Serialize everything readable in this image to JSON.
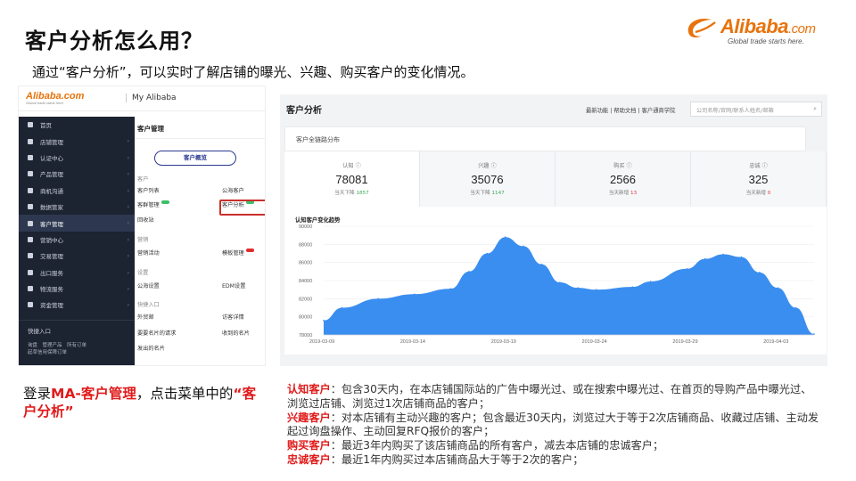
{
  "slide": {
    "title": "客户分析怎么用？",
    "subtitle": "通过“客户分析”，可以实时了解店铺的曝光、兴趣、购买客户的变化情况。"
  },
  "logo": {
    "name": "Alibaba",
    "suffix": ".com",
    "tagline": "Global trade starts here.",
    "reg": "®"
  },
  "left_shot": {
    "logo": "Alibaba.com",
    "logo_tag": "Global trade starts here.",
    "my_alibaba": "My Alibaba",
    "nav": [
      {
        "label": "首页",
        "icon": "home-icon"
      },
      {
        "label": "店铺管理",
        "icon": "store-icon"
      },
      {
        "label": "认证中心",
        "icon": "shield-icon"
      },
      {
        "label": "产品管理",
        "icon": "grid-icon"
      },
      {
        "label": "商机沟通",
        "icon": "chat-icon"
      },
      {
        "label": "数据管家",
        "icon": "chart-icon"
      },
      {
        "label": "客户管理",
        "icon": "user-icon"
      },
      {
        "label": "营销中心",
        "icon": "megaphone-icon"
      },
      {
        "label": "交易管理",
        "icon": "document-icon"
      },
      {
        "label": "出口服务",
        "icon": "globe-icon"
      },
      {
        "label": "物流服务",
        "icon": "truck-icon"
      },
      {
        "label": "资金管理",
        "icon": "bank-icon"
      }
    ],
    "quick_entry": "快捷入口",
    "quick_links_1": "询盘　管理产品　所有订单",
    "quick_links_2": "起草信用保障订单",
    "panel": {
      "title": "客户管理",
      "overview_button": "客户概览",
      "section_customer": "客户",
      "customer_list": "客户列表",
      "public_customers": "公海客户",
      "silent_manage": "客群管理",
      "customer_analysis": "客户分析",
      "recycle": "回收站",
      "section_marketing": "营销",
      "marketing_activity": "营销活动",
      "template_manage": "模板管理",
      "section_settings": "设置",
      "public_settings": "公海设置",
      "edm_settings": "EDM设置",
      "section_quick": "快捷入口",
      "visitors": "外贸邮",
      "visitor_details": "访客详情",
      "card_requests": "要要名片的请求",
      "received_cards": "收到的名片",
      "sent_cards": "发出的名片"
    }
  },
  "right_shot": {
    "title": "客户分析",
    "header_links": "最新功能 | 帮助文档 | 客户通商学院",
    "search_placeholder": "公司名称/官网/联系人姓名/邮箱",
    "distribution_title": "客户全链路分布",
    "stats": [
      {
        "label": "认知",
        "value": "78081",
        "delta_label": "当天下降",
        "delta": "1857",
        "delta_color": "#3aa85c"
      },
      {
        "label": "兴趣",
        "value": "35076",
        "delta_label": "当天下降",
        "delta": "1147",
        "delta_color": "#3aa85c"
      },
      {
        "label": "购买",
        "value": "2566",
        "delta_label": "当天新增",
        "delta": "13",
        "delta_color": "#e0383e"
      },
      {
        "label": "忠诚",
        "value": "325",
        "delta_label": "当天新增",
        "delta": "0",
        "delta_color": "#e0383e"
      }
    ],
    "info_icon": "info-icon"
  },
  "chart_data": {
    "type": "area",
    "title": "认知客户变化趋势",
    "xlabel": "",
    "ylabel": "",
    "x_ticks": [
      "2019-03-09",
      "2019-03-14",
      "2019-03-19",
      "2019-03-24",
      "2019-03-29",
      "2019-04-03"
    ],
    "y_ticks": [
      78000,
      80000,
      82000,
      84000,
      86000,
      88000,
      90000
    ],
    "ylim": [
      78000,
      90000
    ],
    "grid": true,
    "color": "#3a8ef0",
    "series": [
      {
        "values": [
          {
            "x": "2019-03-09",
            "y": 79600
          },
          {
            "x": "2019-03-10",
            "y": 81000
          },
          {
            "x": "2019-03-12",
            "y": 82000
          },
          {
            "x": "2019-03-14",
            "y": 82500
          },
          {
            "x": "2019-03-16",
            "y": 83100
          },
          {
            "x": "2019-03-17",
            "y": 85000
          },
          {
            "x": "2019-03-18",
            "y": 87000
          },
          {
            "x": "2019-03-19",
            "y": 88800
          },
          {
            "x": "2019-03-20",
            "y": 87800
          },
          {
            "x": "2019-03-21",
            "y": 85800
          },
          {
            "x": "2019-03-22",
            "y": 83800
          },
          {
            "x": "2019-03-23",
            "y": 83200
          },
          {
            "x": "2019-03-24",
            "y": 83000
          },
          {
            "x": "2019-03-26",
            "y": 83300
          },
          {
            "x": "2019-03-27",
            "y": 83900
          },
          {
            "x": "2019-03-29",
            "y": 85300
          },
          {
            "x": "2019-03-30",
            "y": 86400
          },
          {
            "x": "2019-03-31",
            "y": 86900
          },
          {
            "x": "2019-04-01",
            "y": 86600
          },
          {
            "x": "2019-04-02",
            "y": 84900
          },
          {
            "x": "2019-04-03",
            "y": 83200
          },
          {
            "x": "2019-04-04",
            "y": 81000
          },
          {
            "x": "2019-04-05",
            "y": 78100
          }
        ]
      }
    ]
  },
  "notes": {
    "login_prefix": "登录",
    "login_menu": "MA-客户管理",
    "login_mid": "，点击菜单中的",
    "login_target": "“客户分析”",
    "definitions": [
      {
        "term": "认知客户",
        "text": "：包含30天内，在本店铺国际站的广告中曝光过、或在搜索中曝光过、在首页的导购产品中曝光过、浏览过店铺、浏览过1次店铺商品的客户；"
      },
      {
        "term": "兴趣客户",
        "text": "：对本店铺有主动兴趣的客户；包含最近30天内，浏览过大于等于2次店铺商品、收藏过店铺、主动发起过询盘操作、主动回复RFQ报价的客户；"
      },
      {
        "term": "购买客户",
        "text": "：最近3年内购买了该店铺商品的所有客户，减去本店铺的忠诚客户；"
      },
      {
        "term": "忠诚客户",
        "text": "：最近1年内购买过本店铺商品大于等于2次的客户；"
      }
    ]
  }
}
